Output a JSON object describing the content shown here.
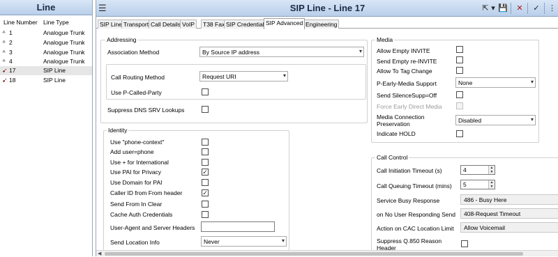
{
  "left_pane": {
    "title": "Line",
    "headers": {
      "number": "Line Number",
      "type": "Line Type"
    },
    "rows": [
      {
        "number": "1",
        "type": "Analogue Trunk",
        "icon": "analogue-trunk-icon"
      },
      {
        "number": "2",
        "type": "Analogue Trunk",
        "icon": "analogue-trunk-icon"
      },
      {
        "number": "3",
        "type": "Analogue Trunk",
        "icon": "analogue-trunk-icon"
      },
      {
        "number": "4",
        "type": "Analogue Trunk",
        "icon": "analogue-trunk-icon"
      },
      {
        "number": "17",
        "type": "SIP Line",
        "icon": "sip-line-icon",
        "selected": true
      },
      {
        "number": "18",
        "type": "SIP Line",
        "icon": "sip-line-icon"
      }
    ]
  },
  "header": {
    "title": "SIP Line - Line 17",
    "menu_icon": "menu-icon",
    "toolbar": [
      "export-icon",
      "dropdown-arrow-icon",
      "save-icon",
      "delete-icon",
      "ok-icon",
      "help-icon"
    ],
    "toolbar_glyphs": {
      "export": "⇱",
      "dropdown": "▾",
      "save": "💾",
      "delete": "✕",
      "ok": "✓",
      "help": "⋮"
    }
  },
  "tabs": [
    "SIP Line",
    "Transport",
    "Call Details",
    "VoIP",
    "T38 Fax",
    "SIP Credentials",
    "SIP Advanced",
    "Engineering"
  ],
  "active_tab": "SIP Advanced",
  "addressing": {
    "title": "Addressing",
    "association_method": {
      "label": "Association Method",
      "value": "By Source IP address"
    },
    "call_routing_method": {
      "label": "Call Routing Method",
      "value": "Request URI"
    },
    "use_p_called_party": {
      "label": "Use P-Called-Party",
      "checked": false
    },
    "suppress_dns_srv": {
      "label": "Suppress DNS SRV Lookups",
      "checked": false
    }
  },
  "identity": {
    "title": "Identity",
    "use_phone_context": {
      "label": "Use \"phone-context\"",
      "checked": false
    },
    "add_user_phone": {
      "label": "Add user=phone",
      "checked": false
    },
    "use_plus_international": {
      "label": "Use + for International",
      "checked": false
    },
    "use_pai_privacy": {
      "label": "Use PAI for Privacy",
      "checked": true
    },
    "use_domain_pai": {
      "label": "Use Domain for PAI",
      "checked": false
    },
    "caller_id_from_header": {
      "label": "Caller ID from From header",
      "checked": true
    },
    "send_from_in_clear": {
      "label": "Send From In Clear",
      "checked": false
    },
    "cache_auth_credentials": {
      "label": "Cache Auth Credentials",
      "checked": false
    },
    "user_agent_headers": {
      "label": "User-Agent and Server Headers",
      "value": ""
    },
    "send_location_info": {
      "label": "Send Location Info",
      "value": "Never"
    }
  },
  "media": {
    "title": "Media",
    "allow_empty_invite": {
      "label": "Allow Empty INVITE",
      "checked": false
    },
    "send_empty_reinvite": {
      "label": "Send Empty re-INVITE",
      "checked": false
    },
    "allow_to_tag_change": {
      "label": "Allow To Tag Change",
      "checked": false
    },
    "p_early_media_support": {
      "label": "P-Early-Media Support",
      "value": "None"
    },
    "send_silencesupp_off": {
      "label": "Send SilenceSupp=Off",
      "checked": false
    },
    "force_early_direct_media": {
      "label": "Force Early Direct Media",
      "checked": false,
      "disabled": true
    },
    "media_connection_preservation": {
      "label_line1": "Media Connection",
      "label_line2": "Preservation",
      "value": "Disabled"
    },
    "indicate_hold": {
      "label": "Indicate HOLD",
      "checked": false
    }
  },
  "call_control": {
    "title": "Call Control",
    "call_initiation_timeout": {
      "label": "Call Initiation Timeout (s)",
      "value": "4"
    },
    "call_queuing_timeout": {
      "label": "Call Queuing Timeout (mins)",
      "value": "5"
    },
    "service_busy_response": {
      "label": "Service Busy Response",
      "value": "486 - Busy Here"
    },
    "no_user_responding": {
      "label": "on No User Responding Send",
      "value": "408-Request Timeout"
    },
    "action_cac_limit": {
      "label": "Action on CAC Location Limit",
      "value": "Allow Voicemail"
    },
    "suppress_q850": {
      "label_line1": "Suppress Q.850 Reason",
      "label_line2": "Header",
      "checked": false
    }
  },
  "glyphs": {
    "checkmark": "✓",
    "dropdown_arrow": "▾",
    "spin_up": "▲",
    "spin_down": "▼",
    "scroll_left": "◀",
    "analogue_icon": "⸛",
    "sip_icon": "➹"
  }
}
